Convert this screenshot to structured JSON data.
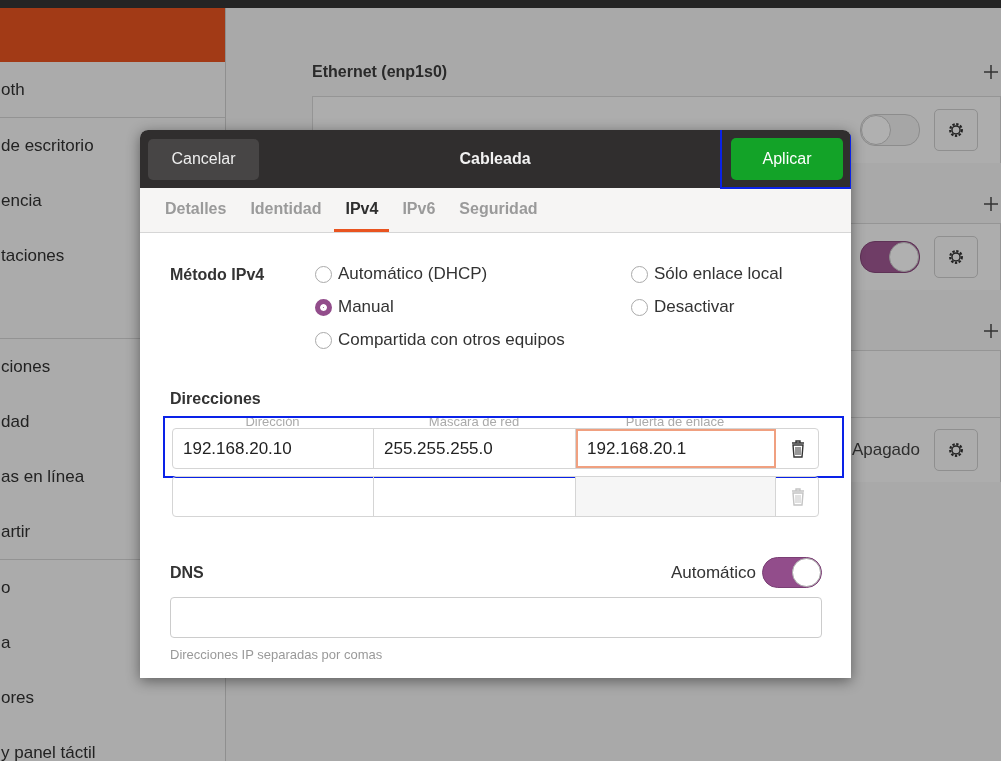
{
  "sidebar": {
    "groups": [
      {
        "items": [
          "oth"
        ]
      },
      {
        "items": [
          "de escritorio",
          "encia",
          "taciones"
        ]
      },
      {
        "items": [
          "ciones",
          "dad",
          "as en línea",
          "artir"
        ]
      },
      {
        "items": [
          "o",
          "a",
          "ores",
          "y panel táctil"
        ]
      }
    ]
  },
  "network": {
    "blocks": [
      {
        "kind": "heading",
        "title": "Ethernet (enp1s0)"
      },
      {
        "kind": "row",
        "on": false
      },
      {
        "kind": "heading"
      },
      {
        "kind": "row",
        "on": true
      },
      {
        "kind": "heading"
      },
      {
        "kind": "row"
      },
      {
        "kind": "row",
        "status": "Apagado"
      }
    ]
  },
  "dialog": {
    "title": "Cableada",
    "cancel": "Cancelar",
    "apply": {
      "label": "Aplicar",
      "highlight": true
    },
    "tabs": [
      {
        "label": "Detalles",
        "selected": false
      },
      {
        "label": "Identidad",
        "selected": false
      },
      {
        "label": "IPv4",
        "selected": true
      },
      {
        "label": "IPv6",
        "selected": false
      },
      {
        "label": "Seguridad",
        "selected": false
      }
    ],
    "method": {
      "label": "Método IPv4",
      "options": [
        {
          "label": "Automático (DHCP)",
          "selected": false
        },
        {
          "label": "Sólo enlace local",
          "selected": false
        },
        {
          "label": "Manual",
          "selected": true
        },
        {
          "label": "Desactivar",
          "selected": false
        },
        {
          "label": "Compartida con otros equipos",
          "selected": false
        }
      ]
    },
    "addresses": {
      "title": "Direcciones",
      "columns": [
        "Dirección",
        "Máscara de red",
        "Puerta de enlace"
      ],
      "rows": [
        {
          "values": [
            "192.168.20.10",
            "255.255.255.0",
            "192.168.20.1"
          ],
          "highlight": true,
          "disabled": false
        },
        {
          "values": [],
          "highlight": false,
          "disabled": true
        }
      ]
    },
    "dns": {
      "title": "DNS",
      "auto_label": "Automático",
      "on": true,
      "hint": "Direcciones IP separadas por comas"
    }
  }
}
